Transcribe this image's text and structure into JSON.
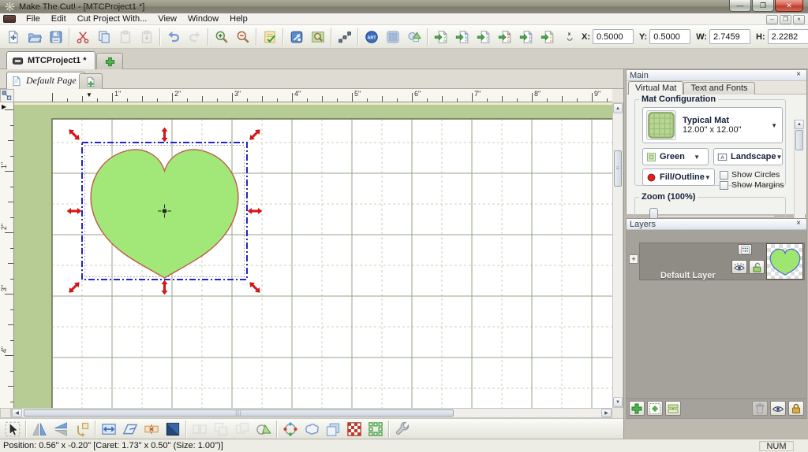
{
  "window": {
    "title": "Make The Cut! - [MTCProject1 *]",
    "controls": {
      "minimize": "—",
      "restore": "❐",
      "close": "✕"
    }
  },
  "menu_bar": {
    "items": [
      "File",
      "Edit",
      "Cut Project With...",
      "View",
      "Window",
      "Help"
    ]
  },
  "toolbar": {
    "groups": [
      {
        "icons": [
          {
            "name": "new-document"
          },
          {
            "name": "open-project"
          },
          {
            "name": "save-project"
          }
        ]
      },
      {
        "icons": [
          {
            "name": "cut"
          },
          {
            "name": "copy"
          },
          {
            "name": "paste",
            "disabled": true
          },
          {
            "name": "paste-in-place",
            "disabled": true
          }
        ]
      },
      {
        "icons": [
          {
            "name": "undo"
          },
          {
            "name": "redo",
            "disabled": true
          }
        ]
      },
      {
        "icons": [
          {
            "name": "zoom-in"
          },
          {
            "name": "zoom-out"
          }
        ]
      },
      {
        "icons": [
          {
            "name": "cut-project-preview"
          }
        ]
      },
      {
        "icons": [
          {
            "name": "mat-tools"
          },
          {
            "name": "mat-preview"
          }
        ]
      },
      {
        "icons": [
          {
            "name": "node-path-edit"
          }
        ]
      },
      {
        "icons": [
          {
            "name": "art-store"
          },
          {
            "name": "basic-shapes"
          },
          {
            "name": "shape-magic"
          }
        ]
      },
      {
        "icons": [
          {
            "name": "import-svg"
          },
          {
            "name": "import-pdf"
          },
          {
            "name": "import-txt"
          },
          {
            "name": "import-wpc"
          },
          {
            "name": "import-gsd"
          },
          {
            "name": "import-scut"
          }
        ]
      }
    ],
    "position_fields": {
      "x_label": "X:",
      "x_value": "0.5000",
      "y_label": "Y:",
      "y_value": "0.5000",
      "w_label": "W:",
      "w_value": "2.7459",
      "h_label": "H:",
      "h_value": "2.2282"
    }
  },
  "project_tabs": {
    "tabs": [
      {
        "label": "MTCProject1 *",
        "active": true
      }
    ]
  },
  "page_tabs": {
    "tabs": [
      {
        "label": "Default Page",
        "active": true
      }
    ]
  },
  "rulers": {
    "top": {
      "unit_labels": [
        "1\"",
        "2\"",
        "3\"",
        "4\"",
        "5\"",
        "6\"",
        "7\"",
        "8\"",
        "9\""
      ]
    },
    "left": {
      "unit_labels": [
        "1\"",
        "2\"",
        "3\"",
        "4\""
      ]
    }
  },
  "canvas": {
    "mat_color": "#b7cc94",
    "grid_line_color": "#96a487",
    "heart_fill": "#a2e878",
    "heart_outline": "#c05a4a",
    "selection_color": "#2323cc",
    "handle_color": "#e41212"
  },
  "side_panels": {
    "main": {
      "title": "Main",
      "close": "×",
      "tabs": [
        {
          "label": "Virtual Mat",
          "active": true
        },
        {
          "label": "Text and Fonts",
          "active": false
        }
      ],
      "mat_configuration": {
        "group_label": "Mat Configuration",
        "mat_name": "Typical Mat",
        "mat_size": "12.00\" x 12.00\"",
        "color_label": "Green",
        "orientation_label": "Landscape",
        "fill_outline_label": "Fill/Outline",
        "show_circles_label": "Show Circles",
        "show_margins_label": "Show Margins",
        "show_circles_checked": false,
        "show_margins_checked": false
      },
      "zoom_group": {
        "label": "Zoom (100%)",
        "value_percent": 100
      }
    },
    "layers": {
      "title": "Layers",
      "close": "×",
      "rows": [
        {
          "name": "Default Layer"
        }
      ],
      "buttons": [
        {
          "name": "add-layer"
        },
        {
          "name": "add-layer-with-selection"
        },
        {
          "name": "merge-layers"
        },
        {
          "name": "delete-layer",
          "disabled": true,
          "push_right": true
        },
        {
          "name": "toggle-visibility"
        },
        {
          "name": "toggle-lock"
        }
      ]
    }
  },
  "bottom_toolbar": {
    "groups": [
      {
        "icons": [
          {
            "name": "selection-tool"
          }
        ]
      },
      {
        "icons": [
          {
            "name": "flip-horizontal"
          },
          {
            "name": "flip-vertical"
          },
          {
            "name": "rotate-90"
          }
        ]
      },
      {
        "icons": [
          {
            "name": "stretch"
          },
          {
            "name": "skew"
          },
          {
            "name": "break-apart"
          },
          {
            "name": "shadow-layer"
          }
        ]
      },
      {
        "icons": [
          {
            "name": "mirror-copies",
            "disabled": true
          },
          {
            "name": "copy-merge",
            "disabled": true
          },
          {
            "name": "copy-overlap",
            "disabled": true
          },
          {
            "name": "weld"
          }
        ]
      },
      {
        "icons": [
          {
            "name": "node-mode"
          },
          {
            "name": "lasso-select"
          },
          {
            "name": "boolean-join"
          },
          {
            "name": "pattern-fill"
          },
          {
            "name": "lattice"
          }
        ]
      },
      {
        "icons": [
          {
            "name": "tools-wrench"
          }
        ]
      }
    ]
  },
  "status_bar": {
    "position_text": "Position: 0.56\" x -0.20\" [Caret: 1.73\" x 0.50\" (Size: 1.00\")]",
    "num_lock": "NUM"
  }
}
